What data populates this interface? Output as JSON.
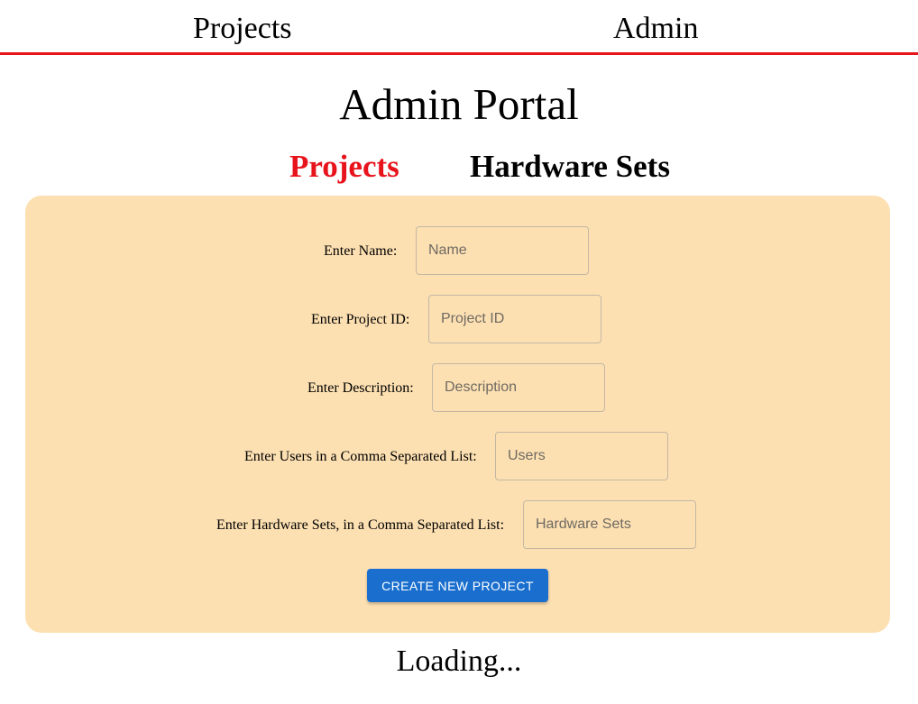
{
  "topnav": {
    "projects_label": "Projects",
    "admin_label": "Admin",
    "accent_color": "#e8141c"
  },
  "page": {
    "title": "Admin Portal",
    "loading_text": "Loading..."
  },
  "tabs": [
    {
      "label": "Projects",
      "active": true,
      "color": "#e8141c"
    },
    {
      "label": "Hardware Sets",
      "active": false,
      "color": "#000000"
    }
  ],
  "form": {
    "background_color": "#fde0b2",
    "fields": [
      {
        "label": "Enter Name:",
        "placeholder": "Name",
        "value": ""
      },
      {
        "label": "Enter Project ID:",
        "placeholder": "Project ID",
        "value": ""
      },
      {
        "label": "Enter Description:",
        "placeholder": "Description",
        "value": ""
      },
      {
        "label": "Enter Users in a Comma Separated List:",
        "placeholder": "Users",
        "value": ""
      },
      {
        "label": "Enter Hardware Sets, in a Comma Separated List:",
        "placeholder": "Hardware Sets",
        "value": ""
      }
    ],
    "submit_label": "CREATE NEW PROJECT",
    "submit_color": "#1a6fce"
  }
}
